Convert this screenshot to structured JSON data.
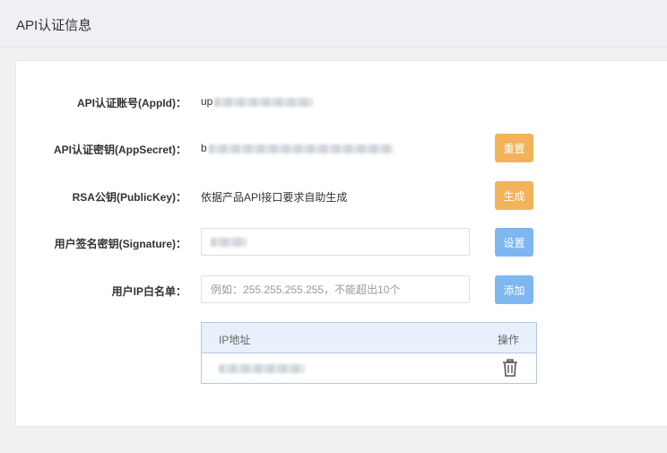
{
  "header": {
    "title": "API认证信息"
  },
  "form": {
    "appid_label": "API认证账号(AppId)：",
    "appid_value": "up",
    "secret_label": "API认证密钥(AppSecret)：",
    "secret_value": "b",
    "reset_button": "重置",
    "rsa_label": "RSA公钥(PublicKey)：",
    "rsa_value": "依据产品API接口要求自助生成",
    "generate_button": "生成",
    "signature_label": "用户签名密钥(Signature)：",
    "set_button": "设置",
    "ip_label": "用户IP白名单：",
    "ip_placeholder": "例如：255.255.255.255，不能超出10个",
    "add_button": "添加"
  },
  "ip_table": {
    "columns": [
      "IP地址",
      "操作"
    ]
  },
  "colors": {
    "orange_button": "#f2b35a",
    "blue_button": "#7eb7ef",
    "table_header": "#e8f1fb"
  },
  "icons": {
    "delete": "trash-icon"
  }
}
